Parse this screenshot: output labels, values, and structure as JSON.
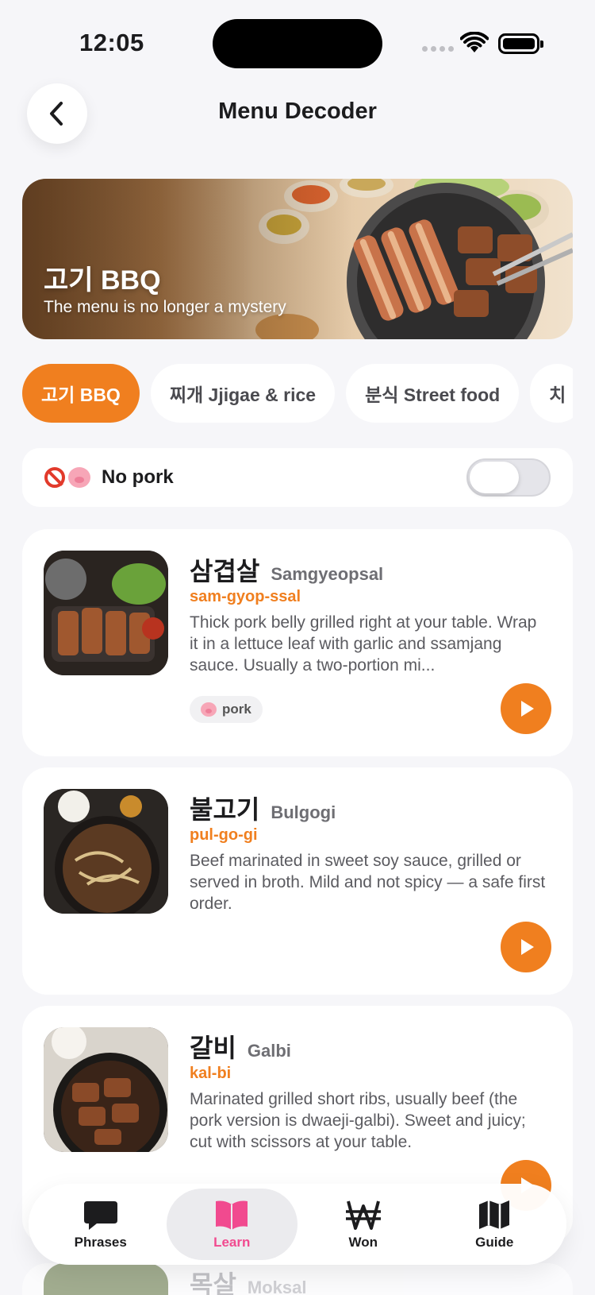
{
  "status_bar": {
    "time": "12:05"
  },
  "header": {
    "title": "Menu Decoder"
  },
  "hero": {
    "title": "고기 BBQ",
    "subtitle": "The menu is no longer a mystery"
  },
  "categories": [
    {
      "label": "고기 BBQ",
      "active": true
    },
    {
      "label": "찌개 Jjigae & rice",
      "active": false
    },
    {
      "label": "분식 Street food",
      "active": false
    },
    {
      "label": "치",
      "active": false
    }
  ],
  "filter": {
    "label": "No pork",
    "enabled": false,
    "icons": [
      "no-entry-icon",
      "pig-icon"
    ]
  },
  "dishes": [
    {
      "name_ko": "삼겹살",
      "name_en": "Samgyeopsal",
      "romanization": "sam-gyop-ssal",
      "description": "Thick pork belly grilled right at your table. Wrap it in a lettuce leaf with garlic and ssamjang sauce. Usually a two-portion mi...",
      "tag": "pork"
    },
    {
      "name_ko": "불고기",
      "name_en": "Bulgogi",
      "romanization": "pul-go-gi",
      "description": "Beef marinated in sweet soy sauce, grilled or served in broth. Mild and not spicy — a safe first order."
    },
    {
      "name_ko": "갈비",
      "name_en": "Galbi",
      "romanization": "kal-bi",
      "description": "Marinated grilled short ribs, usually beef (the pork version is dwaeji-galbi). Sweet and juicy; cut with scissors at your table."
    },
    {
      "name_ko": "목살",
      "name_en": "Moksal"
    }
  ],
  "tabs": [
    {
      "label": "Phrases",
      "icon": "chat-bubble-icon",
      "active": false
    },
    {
      "label": "Learn",
      "icon": "book-icon",
      "active": true
    },
    {
      "label": "Won",
      "icon": "won-currency-icon",
      "active": false
    },
    {
      "label": "Guide",
      "icon": "map-icon",
      "active": false
    }
  ],
  "colors": {
    "accent": "#f07f1f",
    "active_tab": "#f14a8f",
    "background": "#f6f6f9"
  }
}
